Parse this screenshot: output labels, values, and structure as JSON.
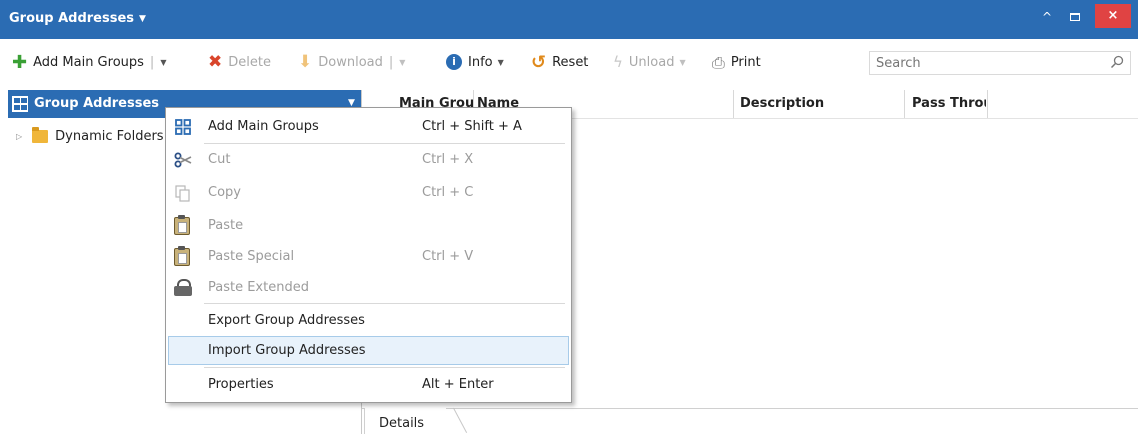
{
  "window": {
    "title": "Group Addresses",
    "title_caret": "▼",
    "minimize_glyph": "^",
    "close_glyph": "×"
  },
  "toolbar": {
    "add_main_groups": "Add Main Groups",
    "delete": "Delete",
    "download": "Download",
    "info": "Info",
    "reset": "Reset",
    "unload": "Unload",
    "print": "Print",
    "separator": "|",
    "dropdown_glyph": "▼",
    "search_placeholder": "Search"
  },
  "left_panel": {
    "header": "Group Addresses",
    "header_caret": "▼",
    "tree": [
      {
        "label": "Dynamic Folders",
        "expander": "▷"
      }
    ]
  },
  "grid": {
    "columns": [
      "Main Group",
      "Name",
      "Description",
      "Pass Through"
    ]
  },
  "bottom_tabs": {
    "details": "Details"
  },
  "context_menu": {
    "items": [
      {
        "label": "Add Main Groups",
        "shortcut": "Ctrl + Shift + A",
        "icon": "add-main-groups-icon",
        "enabled": true
      },
      {
        "label": "Cut",
        "shortcut": "Ctrl + X",
        "icon": "scissors-icon",
        "enabled": false
      },
      {
        "label": "Copy",
        "shortcut": "Ctrl + C",
        "icon": "copy-icon",
        "enabled": false
      },
      {
        "label": "Paste",
        "shortcut": "",
        "icon": "clipboard-icon",
        "enabled": false
      },
      {
        "label": "Paste Special",
        "shortcut": "Ctrl + V",
        "icon": "clipboard-icon",
        "enabled": false
      },
      {
        "label": "Paste Extended",
        "shortcut": "",
        "icon": "lock-icon",
        "enabled": false
      },
      {
        "label": "Export Group Addresses",
        "shortcut": "",
        "icon": "",
        "enabled": true
      },
      {
        "label": "Import Group Addresses",
        "shortcut": "",
        "icon": "",
        "enabled": true,
        "highlighted": true
      },
      {
        "label": "Properties",
        "shortcut": "Alt + Enter",
        "icon": "",
        "enabled": true
      }
    ]
  },
  "colors": {
    "accent": "#2b6cb3",
    "close": "#e04343",
    "add": "#3aa035",
    "delete": "#d9452b",
    "info": "#2b6cb3",
    "reset": "#e08a1c",
    "menu_highlight": "#e8f2fb"
  }
}
